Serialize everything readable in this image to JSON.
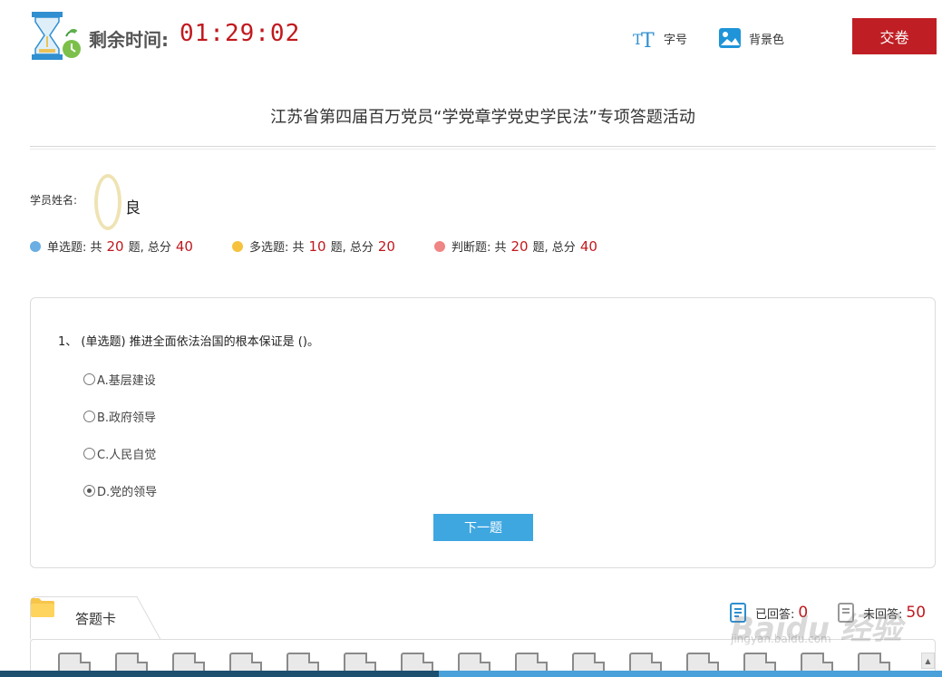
{
  "header": {
    "time_label": "剩余时间:",
    "time_value": "01:29:02",
    "font_size_label": "字号",
    "background_label": "背景色",
    "submit_label": "交卷"
  },
  "title": "江苏省第四届百万党员“学党章学党史学民法”专项答题活动",
  "student": {
    "label": "学员姓名:",
    "name": "良"
  },
  "stats": [
    {
      "name": "单选题",
      "prefix": "单选题: 共",
      "count": "20",
      "mid": "题, 总分",
      "score": "40",
      "color": "#6aaee3"
    },
    {
      "name": "多选题",
      "prefix": "多选题: 共",
      "count": "10",
      "mid": "题, 总分",
      "score": "20",
      "color": "#f6c23e"
    },
    {
      "name": "判断题",
      "prefix": "判断题: 共",
      "count": "20",
      "mid": "题, 总分",
      "score": "40",
      "color": "#f08585"
    }
  ],
  "question": {
    "text": "1、 (单选题) 推进全面依法治国的根本保证是 ()。",
    "options": [
      {
        "label": "A.基层建设",
        "checked": false
      },
      {
        "label": "B.政府领导",
        "checked": false
      },
      {
        "label": "C.人民自觉",
        "checked": false
      },
      {
        "label": "D.党的领导",
        "checked": true
      }
    ],
    "next_label": "下一题"
  },
  "answer_card": {
    "label": "答题卡",
    "answered_label": "已回答:",
    "answered_count": "0",
    "unanswered_label": "未回答:",
    "unanswered_count": "50"
  },
  "watermark": {
    "text": "Baidu 经验",
    "url": "jingyan.baidu.com"
  },
  "colors": {
    "accent_red": "#c0191e",
    "submit_bg": "#bf1f24",
    "next_bg": "#3ea7e0"
  }
}
